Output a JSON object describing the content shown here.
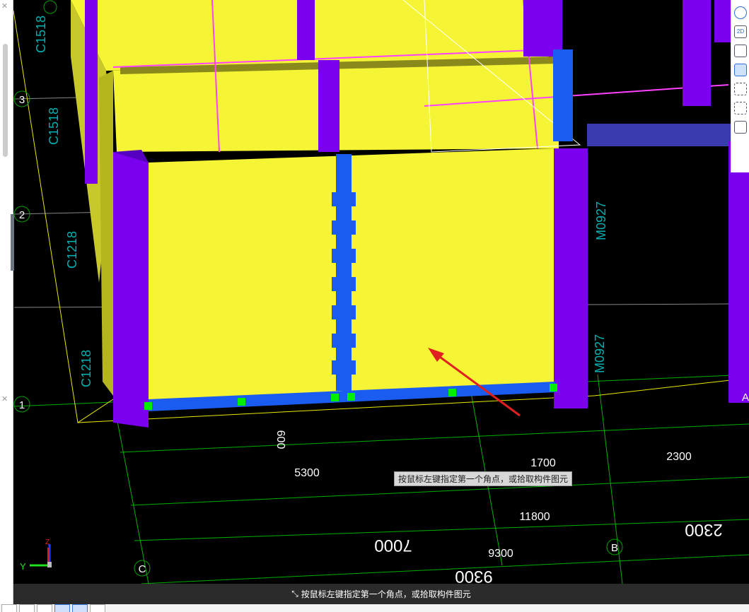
{
  "status_prompt": "按鼠标左键指定第一个角点，或拾取构件图元",
  "tooltip": "按鼠标左键指定第一个角点，或拾取构件图元",
  "axes": {
    "a1": "1",
    "a2": "2",
    "a3": "3",
    "aC": "C",
    "aB": "B",
    "aA": "A"
  },
  "labels": {
    "c1": "C1518",
    "c2": "C1518",
    "c3": "C1218",
    "c4": "C1218",
    "m1": "M0927",
    "m2": "M0927"
  },
  "dims": {
    "d600": "600",
    "d5300": "5300",
    "d1700": "1700",
    "d2300": "2300",
    "d11800": "11800",
    "d7000": "7000",
    "d9300": "9300",
    "d2300b": "2300",
    "d9300b": "9300"
  },
  "right_toolbar": [
    "orbit",
    "2D",
    "view-cube",
    "view-cube-solid",
    "select-box",
    "3d-box",
    "properties"
  ],
  "axis_indicator": {
    "y": "Y",
    "z": "Z"
  },
  "colors": {
    "wall": "#f5f535",
    "column": "#7b00f0",
    "beam": "#1a5cf0",
    "grid": "#00c000"
  }
}
